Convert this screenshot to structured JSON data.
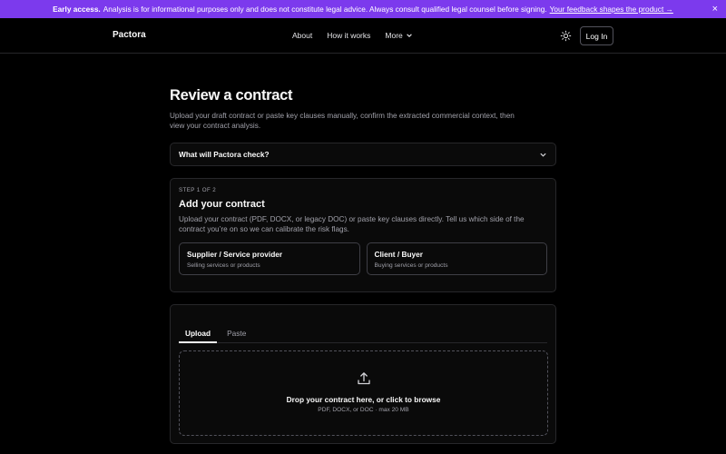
{
  "banner": {
    "label": "Early access.",
    "message": "Analysis is for informational purposes only and does not constitute legal advice. Always consult qualified legal counsel before signing.",
    "link": "Your feedback shapes the product →",
    "close": "×",
    "color": "#7c3aed"
  },
  "nav": {
    "logo": "Pactora",
    "links": [
      "About",
      "How it works",
      "More"
    ],
    "theme_icon": "sun-icon",
    "login": "Log In"
  },
  "page": {
    "title": "Review a contract",
    "subtitle": "Upload your draft contract or paste key clauses manually, confirm the extracted commercial context, then view your contract analysis."
  },
  "accordion": {
    "label": "What will Pactora check?"
  },
  "step": {
    "indicator": "STEP 1 OF 2",
    "title": "Add your contract",
    "description": "Upload your contract (PDF, DOCX, or legacy DOC) or paste key clauses directly. Tell us which side of the contract you’re on so we can calibrate the risk flags.",
    "roles": [
      {
        "title": "Supplier / Service provider",
        "subtitle": "Selling services or products"
      },
      {
        "title": "Client / Buyer",
        "subtitle": "Buying services or products"
      }
    ]
  },
  "input": {
    "tabs": [
      "Upload",
      "Paste"
    ],
    "active_tab": "Upload",
    "drop_title": "Drop your contract here, or click to browse",
    "drop_subtitle": "PDF, DOCX, or DOC · max 20 MB"
  }
}
